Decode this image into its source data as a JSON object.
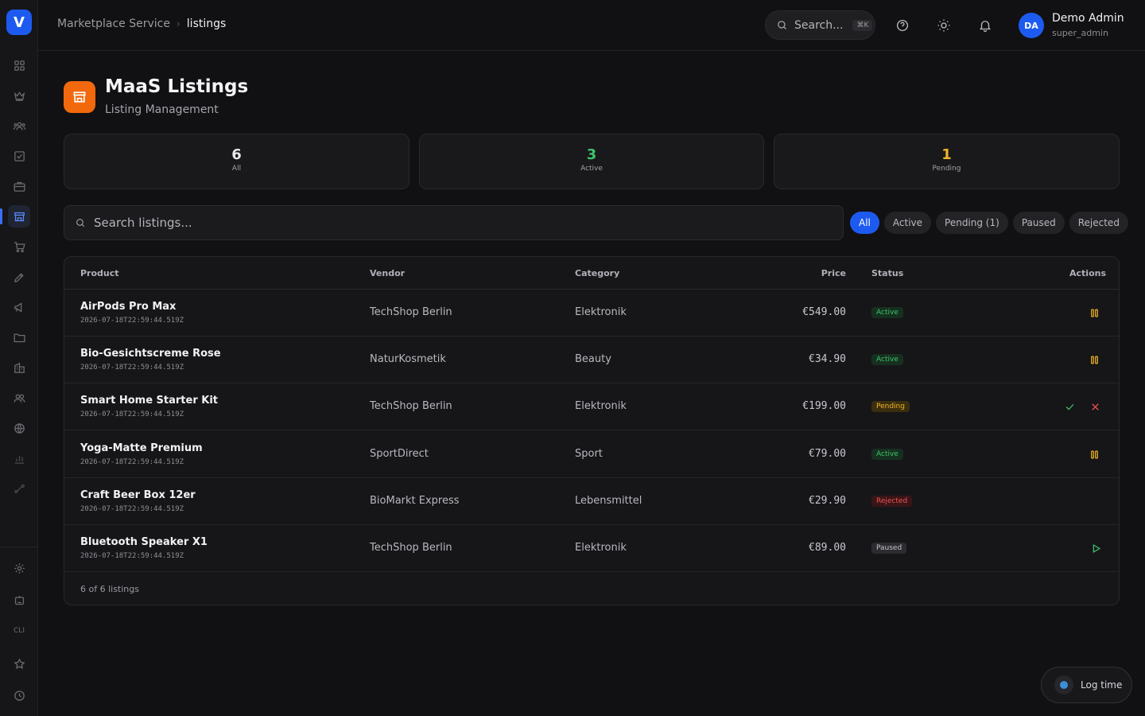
{
  "app": {
    "logo_letter": "V"
  },
  "breadcrumb": {
    "parent": "Marketplace Service",
    "separator": "›",
    "current": "listings"
  },
  "topbar": {
    "search_placeholder": "Search...",
    "search_shortcut": "⌘K",
    "user": {
      "initials": "DA",
      "name": "Demo Admin",
      "role": "super_admin"
    }
  },
  "header": {
    "title": "MaaS Listings",
    "subtitle": "Listing Management"
  },
  "stats": [
    {
      "value": "6",
      "label": "All",
      "color": "#e8e8ea"
    },
    {
      "value": "3",
      "label": "Active",
      "color": "#3ec26b"
    },
    {
      "value": "1",
      "label": "Pending",
      "color": "#f0b429"
    }
  ],
  "search": {
    "placeholder": "Search listings..."
  },
  "filters": [
    "All",
    "Active",
    "Pending (1)",
    "Paused",
    "Rejected"
  ],
  "active_filter": "All",
  "table": {
    "columns": [
      "Product",
      "Vendor",
      "Category",
      "Price",
      "Status",
      "Actions"
    ],
    "rows": [
      {
        "product": "AirPods Pro Max",
        "date": "2026-07-18T22:59:44.519Z",
        "vendor": "TechShop Berlin",
        "category": "Elektronik",
        "price": "€549.00",
        "status": "Active",
        "actions": [
          "pause"
        ]
      },
      {
        "product": "Bio-Gesichtscreme Rose",
        "date": "2026-07-18T22:59:44.519Z",
        "vendor": "NaturKosmetik",
        "category": "Beauty",
        "price": "€34.90",
        "status": "Active",
        "actions": [
          "pause"
        ]
      },
      {
        "product": "Smart Home Starter Kit",
        "date": "2026-07-18T22:59:44.519Z",
        "vendor": "TechShop Berlin",
        "category": "Elektronik",
        "price": "€199.00",
        "status": "Pending",
        "actions": [
          "approve",
          "reject"
        ]
      },
      {
        "product": "Yoga-Matte Premium",
        "date": "2026-07-18T22:59:44.519Z",
        "vendor": "SportDirect",
        "category": "Sport",
        "price": "€79.00",
        "status": "Active",
        "actions": [
          "pause"
        ]
      },
      {
        "product": "Craft Beer Box 12er",
        "date": "2026-07-18T22:59:44.519Z",
        "vendor": "BioMarkt Express",
        "category": "Lebensmittel",
        "price": "€29.90",
        "status": "Rejected",
        "actions": []
      },
      {
        "product": "Bluetooth Speaker X1",
        "date": "2026-07-18T22:59:44.519Z",
        "vendor": "TechShop Berlin",
        "category": "Elektronik",
        "price": "€89.00",
        "status": "Paused",
        "actions": [
          "play"
        ]
      }
    ],
    "footer": "6 of 6 listings"
  },
  "sidebar": {
    "icons": [
      "dashboard-icon",
      "crown-icon",
      "users-group-icon",
      "checkbox-icon",
      "briefcase-icon",
      "store-icon",
      "cart-icon",
      "pen-nib-icon",
      "megaphone-icon",
      "folder-icon",
      "building-icon",
      "people-icon",
      "globe-icon",
      "bar-chart-icon",
      "route-icon"
    ],
    "active": "store-icon",
    "bottom_icons": [
      "settings-icon",
      "bot-icon",
      "cli-icon",
      "star-icon",
      "clock-icon"
    ],
    "cli_label": "CLI"
  },
  "log_time": {
    "label": "Log time"
  },
  "colors": {
    "accent": "#1d5bf0",
    "brand_orange": "#f2690d",
    "success": "#3ec26b",
    "warning": "#f0b429",
    "danger": "#f05252"
  }
}
